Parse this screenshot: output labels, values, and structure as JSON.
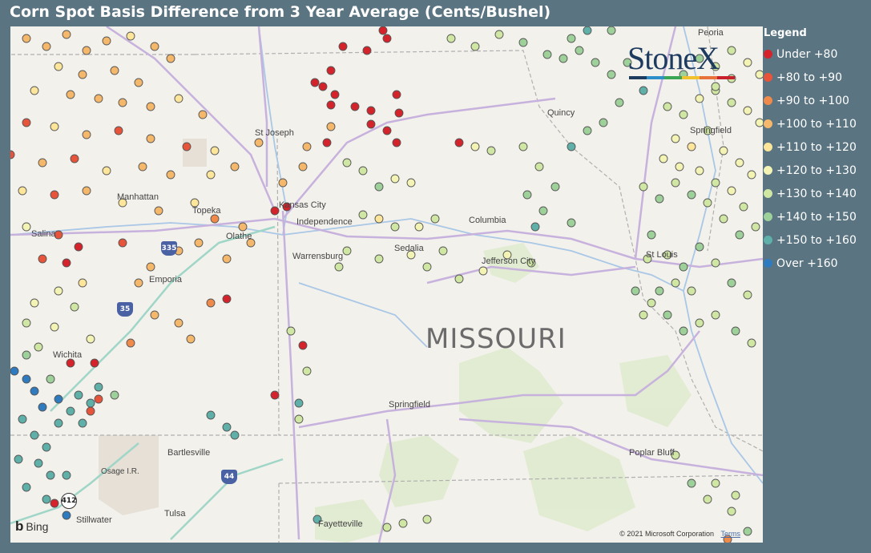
{
  "title": "Corn Spot Basis Difference from 3 Year Average (Cents/Bushel)",
  "legend": {
    "title": "Legend",
    "items": [
      {
        "label": "Under +80",
        "color": "#d4232b"
      },
      {
        "label": "+80 to +90",
        "color": "#e8543a"
      },
      {
        "label": "+90 to +100",
        "color": "#f08a4b"
      },
      {
        "label": "+100 to +110",
        "color": "#f5b86a"
      },
      {
        "label": "+110 to +120",
        "color": "#fde59a"
      },
      {
        "label": "+120 to +130",
        "color": "#f3f4b4"
      },
      {
        "label": "+130 to +140",
        "color": "#cfe7a2"
      },
      {
        "label": "+140 to +150",
        "color": "#9ed19a"
      },
      {
        "label": "+150 to +160",
        "color": "#5fb0a8"
      },
      {
        "label": "Over +160",
        "color": "#2f7bbf"
      }
    ]
  },
  "map": {
    "state_label": "MISSOURI",
    "cities": [
      "St Joseph",
      "Manhattan",
      "Topeka",
      "Kansas City",
      "Independence",
      "Olathe",
      "Salina",
      "Emporia",
      "Warrensburg",
      "Sedalia",
      "Columbia",
      "Jefferson City",
      "St Louis",
      "Wichita",
      "Springfield",
      "Bartlesville",
      "Osage I.R.",
      "Poplar Bluff",
      "Stillwater",
      "Tulsa",
      "Fayetteville",
      "Peoria",
      "Quincy",
      "Springfield"
    ],
    "highways": [
      "335",
      "35",
      "44",
      "412"
    ],
    "provider": "Bing",
    "attribution": "© 2021 Microsoft Corporation",
    "terms_link": "Terms"
  },
  "logo": {
    "text": "StoneX"
  }
}
